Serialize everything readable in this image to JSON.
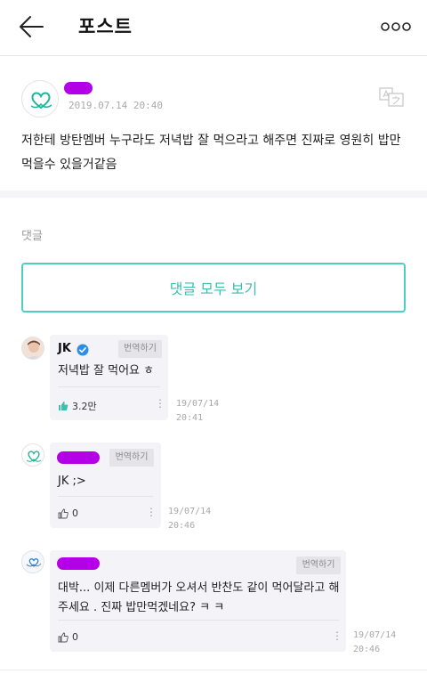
{
  "header": {
    "title": "포스트",
    "back_icon": "arrow-left-icon",
    "more_icon": "more-horizontal-icon"
  },
  "post": {
    "date": "2019.07.14 20:40",
    "body": "저한테 방탄멤버 누구라도 저녁밥 잘 먹으라고 해주면 진짜로 영원히 밥만 먹을수 있을거같음",
    "translate_icon": "translate-icon",
    "redaction_color": "#b300e6"
  },
  "comments_label": "댓글",
  "view_all_label": "댓글 모두 보기",
  "accent_color": "#4ccfc0",
  "comments": [
    {
      "author": "JK",
      "verified": true,
      "translate_label": "번역하기",
      "text": "저녁밥 잘 먹어요 ㅎ",
      "likes": "3.2만",
      "liked": true,
      "date_line1": "19/07/14",
      "date_line2": "20:41"
    },
    {
      "author_redacted": true,
      "translate_label": "번역하기",
      "text": "JK ;>",
      "likes": "0",
      "liked": false,
      "date_line1": "19/07/14",
      "date_line2": "20:46"
    },
    {
      "author_redacted": true,
      "translate_label": "번역하기",
      "text": "대박... 이제 다른멤버가 오셔서 반찬도 같이 먹어달라고 해주세요 . 진짜 밥만먹겠네요? ㅋ ㅋ",
      "likes": "0",
      "liked": false,
      "date_line1": "19/07/14",
      "date_line2": "20:46"
    }
  ]
}
